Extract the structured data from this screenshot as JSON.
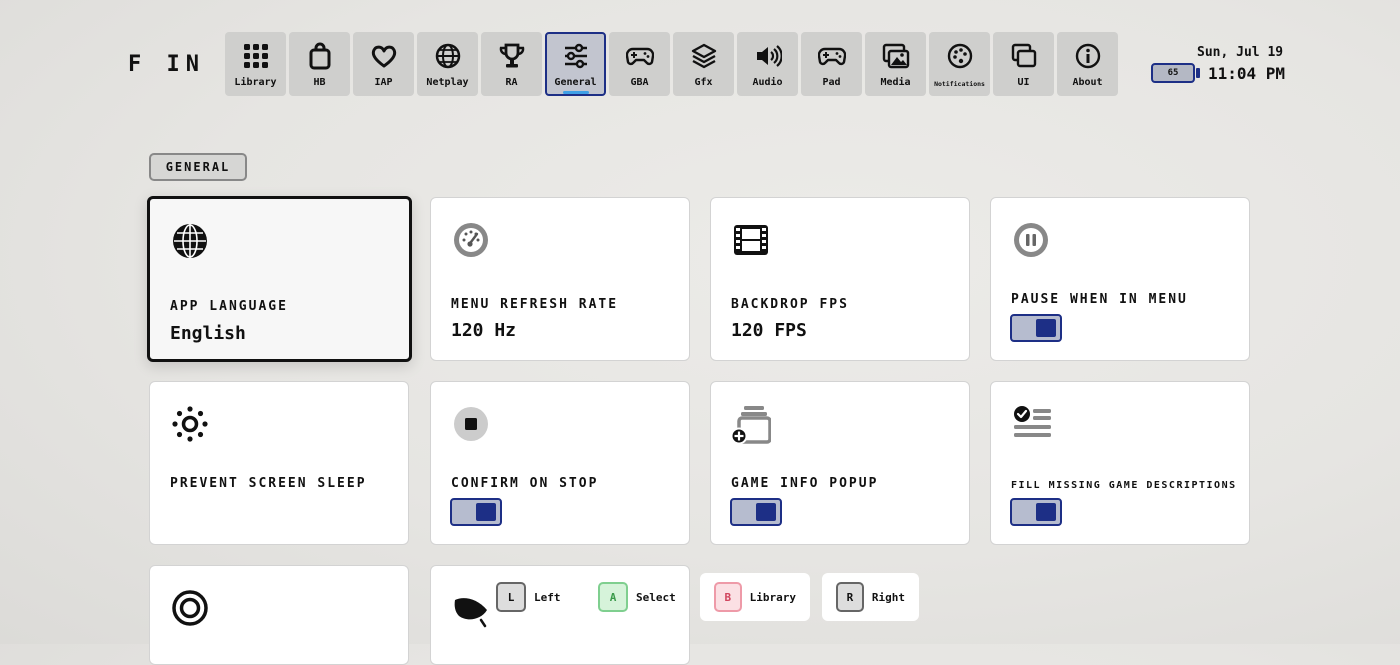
{
  "app": {
    "brand": "F IN"
  },
  "nav": {
    "items": [
      {
        "label": "Library",
        "icon": "grid-icon"
      },
      {
        "label": "HB",
        "icon": "shopping-bag-icon"
      },
      {
        "label": "IAP",
        "icon": "heart-icon"
      },
      {
        "label": "Netplay",
        "icon": "globe-icon"
      },
      {
        "label": "RA",
        "icon": "trophy-icon"
      },
      {
        "label": "General",
        "icon": "sliders-icon",
        "active": true
      },
      {
        "label": "GBA",
        "icon": "gamepad-icon"
      },
      {
        "label": "Gfx",
        "icon": "layers-icon"
      },
      {
        "label": "Audio",
        "icon": "speaker-icon"
      },
      {
        "label": "Pad",
        "icon": "controller-icon"
      },
      {
        "label": "Media",
        "icon": "images-icon"
      },
      {
        "label": "Notifications",
        "icon": "palette-icon"
      },
      {
        "label": "UI",
        "icon": "windows-icon"
      },
      {
        "label": "About",
        "icon": "info-icon"
      }
    ]
  },
  "status": {
    "date": "Sun, Jul 19",
    "time": "11:04 PM",
    "battery": "65",
    "accent": "#1d2f86"
  },
  "section": {
    "title": "GENERAL"
  },
  "settings": {
    "app_language": {
      "label": "APP LANGUAGE",
      "value": "English"
    },
    "menu_refresh_rate": {
      "label": "MENU REFRESH RATE",
      "value": "120 Hz"
    },
    "backdrop_fps": {
      "label": "BACKDROP FPS",
      "value": "120 FPS"
    },
    "pause_when_in_menu": {
      "label": "PAUSE WHEN IN MENU",
      "enabled": true
    },
    "prevent_screen_sleep": {
      "label": "PREVENT SCREEN SLEEP"
    },
    "confirm_on_stop": {
      "label": "CONFIRM ON STOP",
      "enabled": true
    },
    "game_info_popup": {
      "label": "GAME INFO POPUP",
      "enabled": true
    },
    "fill_missing_game_descriptions": {
      "label": "FILL MISSING GAME DESCRIPTIONS",
      "enabled": true
    }
  },
  "hints": {
    "left": {
      "key": "L",
      "label": "Left"
    },
    "select": {
      "key": "A",
      "label": "Select"
    },
    "library": {
      "key": "B",
      "label": "Library"
    },
    "right": {
      "key": "R",
      "label": "Right"
    }
  }
}
